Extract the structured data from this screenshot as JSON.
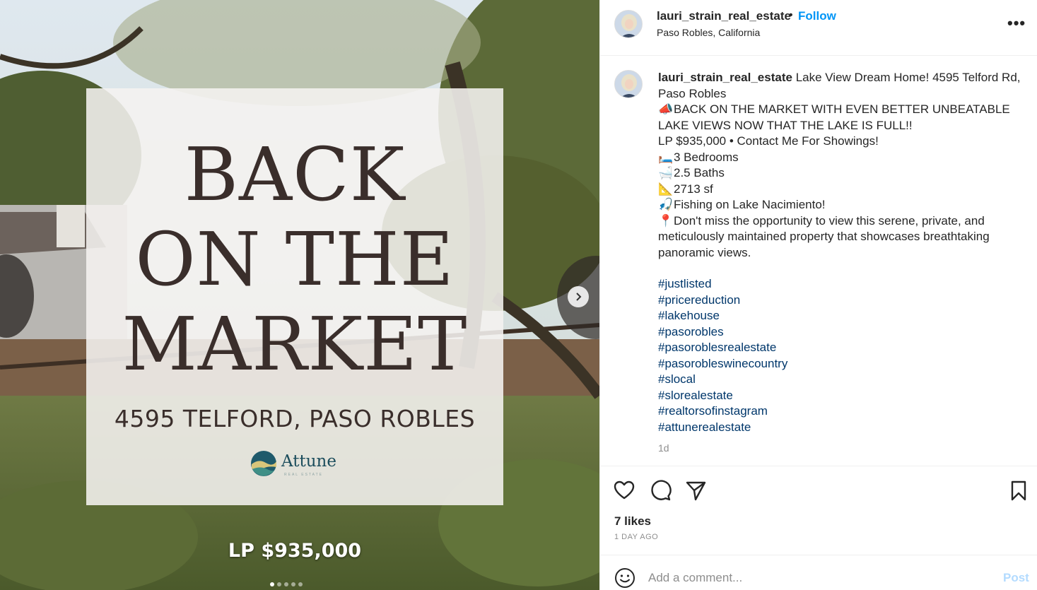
{
  "media": {
    "headline_lines": [
      "BACK",
      "ON THE",
      "MARKET"
    ],
    "address": "4595 TELFORD, PASO ROBLES",
    "logo_name": "Attune",
    "logo_sub": "REAL ESTATE",
    "price": "LP $935,000",
    "dots": 5,
    "active_dot": 0
  },
  "header": {
    "username": "lauri_strain_real_estate",
    "bullet": "•",
    "follow": "Follow",
    "location": "Paso Robles, California"
  },
  "caption": {
    "username": "lauri_strain_real_estate",
    "title": "Lake View Dream Home! 4595 Telford Rd, Paso Robles",
    "lines": [
      {
        "emoji": "📣",
        "text": "BACK ON THE MARKET WITH EVEN BETTER UNBEATABLE LAKE VIEWS NOW THAT THE LAKE IS FULL!!"
      },
      {
        "emoji": "",
        "text": "LP $935,000 • Contact Me For Showings!"
      },
      {
        "emoji": "🛏️",
        "text": "3 Bedrooms"
      },
      {
        "emoji": "🛁",
        "text": "2.5 Baths"
      },
      {
        "emoji": "📐",
        "text": "2713 sf"
      },
      {
        "emoji": "🎣",
        "text": "Fishing on Lake Nacimiento!"
      },
      {
        "emoji": "📍",
        "text": "Don't miss the opportunity to view this serene, private, and meticulously maintained property that showcases breathtaking panoramic views."
      }
    ],
    "hashtags": [
      "#justlisted",
      "#pricereduction",
      "#lakehouse",
      "#pasorobles",
      "#pasoroblesrealestate",
      "#pasorobleswinecountry",
      "#slocal",
      "#slorealestate",
      "#realtorsofinstagram",
      "#attunerealestate"
    ],
    "time_ago": "1d"
  },
  "engagement": {
    "likes": "7 likes",
    "date": "1 DAY AGO"
  },
  "comment": {
    "placeholder": "Add a comment...",
    "post": "Post"
  },
  "colors": {
    "link": "#00376b",
    "follow": "#0095f6",
    "post_disabled": "#b3dbff",
    "headline": "#3a2e2b"
  }
}
